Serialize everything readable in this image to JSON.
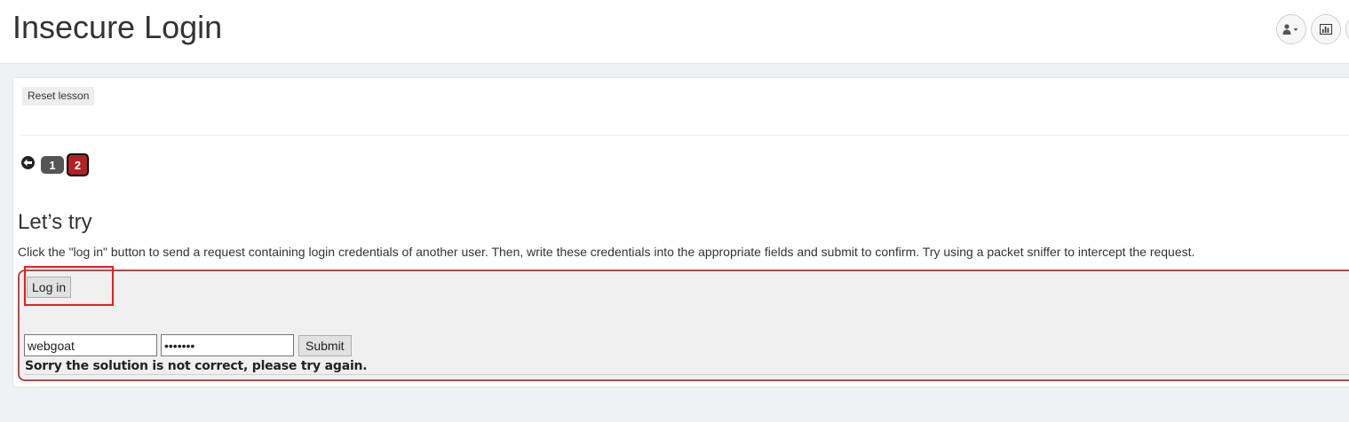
{
  "header": {
    "title": "Insecure Login",
    "buttons": [
      {
        "icon": "user-icon"
      },
      {
        "icon": "bar-chart-icon"
      }
    ]
  },
  "toolbar": {
    "reset_label": "Reset lesson"
  },
  "pagination": {
    "prev_icon": "arrow-left-circle-icon",
    "pages": [
      "1",
      "2"
    ],
    "current": "2"
  },
  "lesson": {
    "title": "Let’s try",
    "description": "Click the \"log in\" button to send a request containing login credentials of another user. Then, write these credentials into the appropriate fields and submit to confirm. Try using a packet sniffer to intercept the request."
  },
  "attack": {
    "login_label": "Log in",
    "username_value": "webgoat",
    "password_value": "webgoat",
    "submit_label": "Submit",
    "feedback": "Sorry the solution is not correct, please try again."
  },
  "colors": {
    "current_page": "#b22222",
    "page": "#555555",
    "attack_border": "#b04c4c",
    "highlight": "#ee1c1c"
  }
}
